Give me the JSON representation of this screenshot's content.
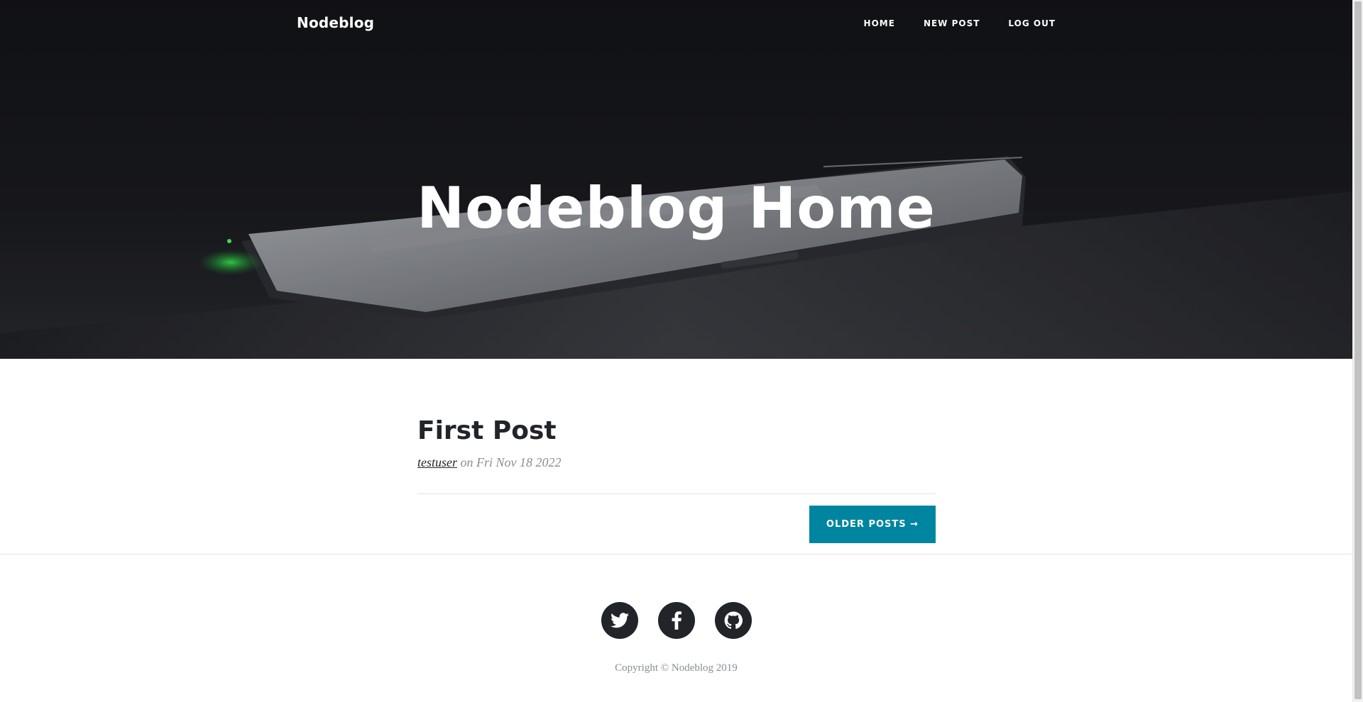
{
  "navbar": {
    "brand": "Nodeblog",
    "links": [
      {
        "label": "HOME"
      },
      {
        "label": "NEW POST"
      },
      {
        "label": "LOG OUT"
      }
    ]
  },
  "masthead": {
    "heading": "Nodeblog Home"
  },
  "posts": [
    {
      "title": "First Post",
      "author": "testuser",
      "meta_connector": "on",
      "date": "Fri Nov 18 2022"
    }
  ],
  "pager": {
    "older_label": "OLDER POSTS →"
  },
  "footer": {
    "social": [
      {
        "icon": "twitter-icon"
      },
      {
        "icon": "facebook-icon"
      },
      {
        "icon": "github-icon"
      }
    ],
    "copyright": "Copyright © Nodeblog 2019"
  },
  "colors": {
    "accent": "#0085a1",
    "dark": "#212529",
    "muted": "#868e96"
  }
}
